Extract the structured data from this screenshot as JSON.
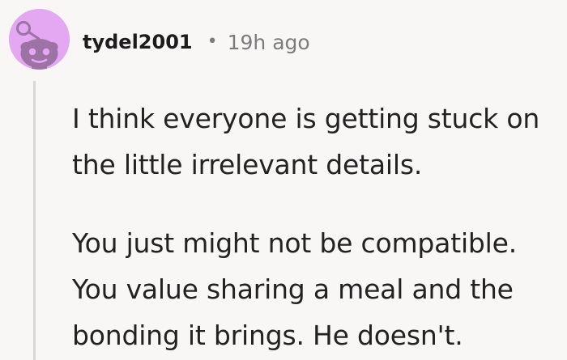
{
  "comment": {
    "username": "tydel2001",
    "separator": "•",
    "timestamp": "19h ago",
    "avatar_icon": "reddit-snoo-avatar-icon",
    "avatar_color": "#e3a8f1",
    "thread_line_color": "#d9d7d4",
    "paragraphs": [
      "I think everyone is getting stuck on the little irrelevant details.",
      "You just might not be compatible. You value sharing a meal and the bonding it brings. He doesn't."
    ]
  }
}
